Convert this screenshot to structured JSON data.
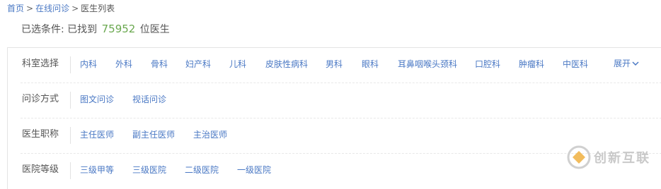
{
  "breadcrumb": {
    "items": [
      {
        "label": "首页"
      },
      {
        "label": "在线问诊"
      },
      {
        "label": "医生列表"
      }
    ],
    "separator": ">"
  },
  "summary": {
    "prefix": "已选条件:",
    "found_prefix": "已找到",
    "count": "75952",
    "suffix": "位医生"
  },
  "filters": {
    "department": {
      "label": "科室选择",
      "options": [
        "内科",
        "外科",
        "骨科",
        "妇产科",
        "儿科",
        "皮肤性病科",
        "男科",
        "眼科",
        "耳鼻咽喉头颈科",
        "口腔科",
        "肿瘤科",
        "中医科"
      ],
      "expand_label": "展开"
    },
    "consult_mode": {
      "label": "问诊方式",
      "options": [
        "图文问诊",
        "视话问诊"
      ]
    },
    "doctor_title": {
      "label": "医生职称",
      "options": [
        "主任医师",
        "副主任医师",
        "主治医师"
      ]
    },
    "hospital_level": {
      "label": "医院等级",
      "options": [
        "三级甲等",
        "三级医院",
        "二级医院",
        "一级医院"
      ]
    }
  },
  "watermark": {
    "text": "创新互联"
  },
  "colors": {
    "link": "#4a78c4",
    "count": "#6aa84f",
    "text": "#555555",
    "border": "#e4e4e4"
  }
}
